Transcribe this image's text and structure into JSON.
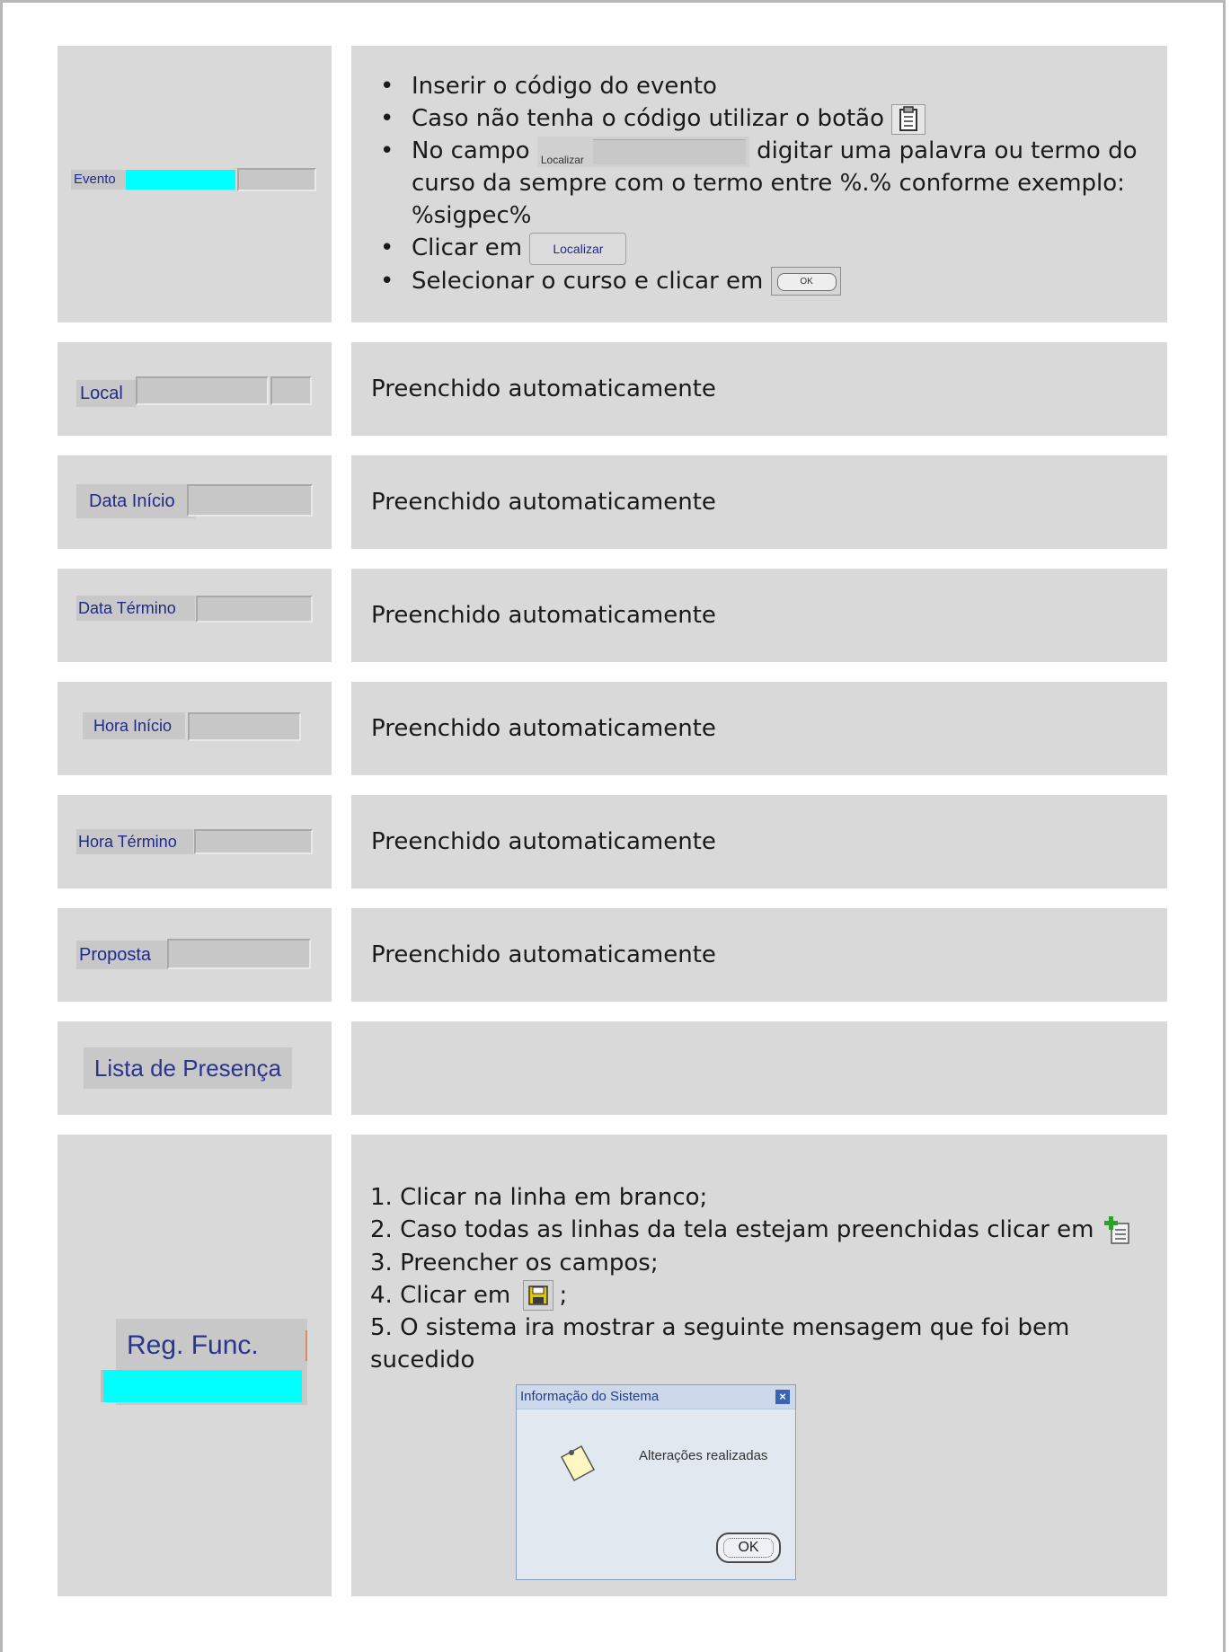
{
  "rows": {
    "evento": {
      "label": "Evento",
      "bullets": {
        "b1": "Inserir o código do evento",
        "b2": "Caso não tenha o código utilizar o botão",
        "b3a": "No campo",
        "b3_field_label": "Localizar",
        "b3b": "digitar uma palavra ou termo do curso da sempre com o termo entre %.% conforme exemplo: %sigpec%",
        "b4": "Clicar em",
        "b4_button": "Localizar",
        "b5": "Selecionar o curso e clicar em",
        "b5_button": "OK"
      }
    },
    "local": {
      "label": "Local",
      "desc": "Preenchido automaticamente"
    },
    "data_inicio": {
      "label": "Data Início",
      "desc": "Preenchido automaticamente"
    },
    "data_termino": {
      "label": "Data Término",
      "desc": "Preenchido automaticamente"
    },
    "hora_inicio": {
      "label": "Hora Início",
      "desc": "Preenchido automaticamente"
    },
    "hora_termino": {
      "label": "Hora Término",
      "desc": "Preenchido automaticamente"
    },
    "proposta": {
      "label": "Proposta",
      "desc": "Preenchido automaticamente"
    },
    "lista": {
      "label": "Lista de Presença"
    },
    "reg_func": {
      "label": "Reg. Func.",
      "steps": {
        "s1": "1. Clicar na linha em branco;",
        "s2": "2. Caso todas as linhas da tela estejam preenchidas clicar em",
        "s3": "3. Preencher os campos;",
        "s4a": "4. Clicar em",
        "s4b": ";",
        "s5": "5. O sistema ira mostrar a seguinte mensagem que foi bem sucedido"
      },
      "dialog": {
        "title": "Informação do Sistema",
        "close": "×",
        "message": "Alterações realizadas",
        "ok": "OK"
      }
    }
  },
  "colors": {
    "cell": "#d9d9d9",
    "field_cyan": "#00ffff",
    "label_blue": "#1f2a8c"
  },
  "icons": [
    "clipboard-icon",
    "new-record-icon",
    "save-icon",
    "note-icon",
    "close-icon"
  ]
}
